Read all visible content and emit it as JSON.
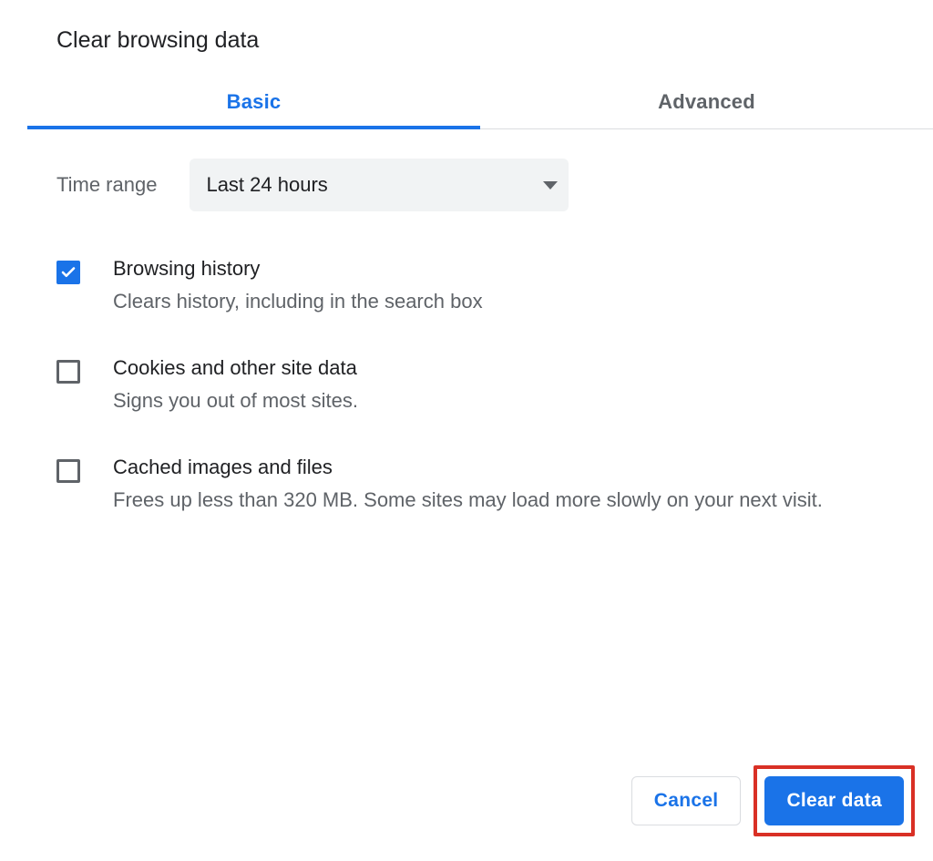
{
  "title": "Clear browsing data",
  "tabs": {
    "basic": "Basic",
    "advanced": "Advanced",
    "active": "basic"
  },
  "time": {
    "label": "Time range",
    "selected": "Last 24 hours"
  },
  "options": [
    {
      "checked": true,
      "title": "Browsing history",
      "desc": "Clears history, including in the search box"
    },
    {
      "checked": false,
      "title": "Cookies and other site data",
      "desc": "Signs you out of most sites."
    },
    {
      "checked": false,
      "title": "Cached images and files",
      "desc": "Frees up less than 320 MB. Some sites may load more slowly on your next visit."
    }
  ],
  "buttons": {
    "cancel": "Cancel",
    "clear": "Clear data"
  }
}
